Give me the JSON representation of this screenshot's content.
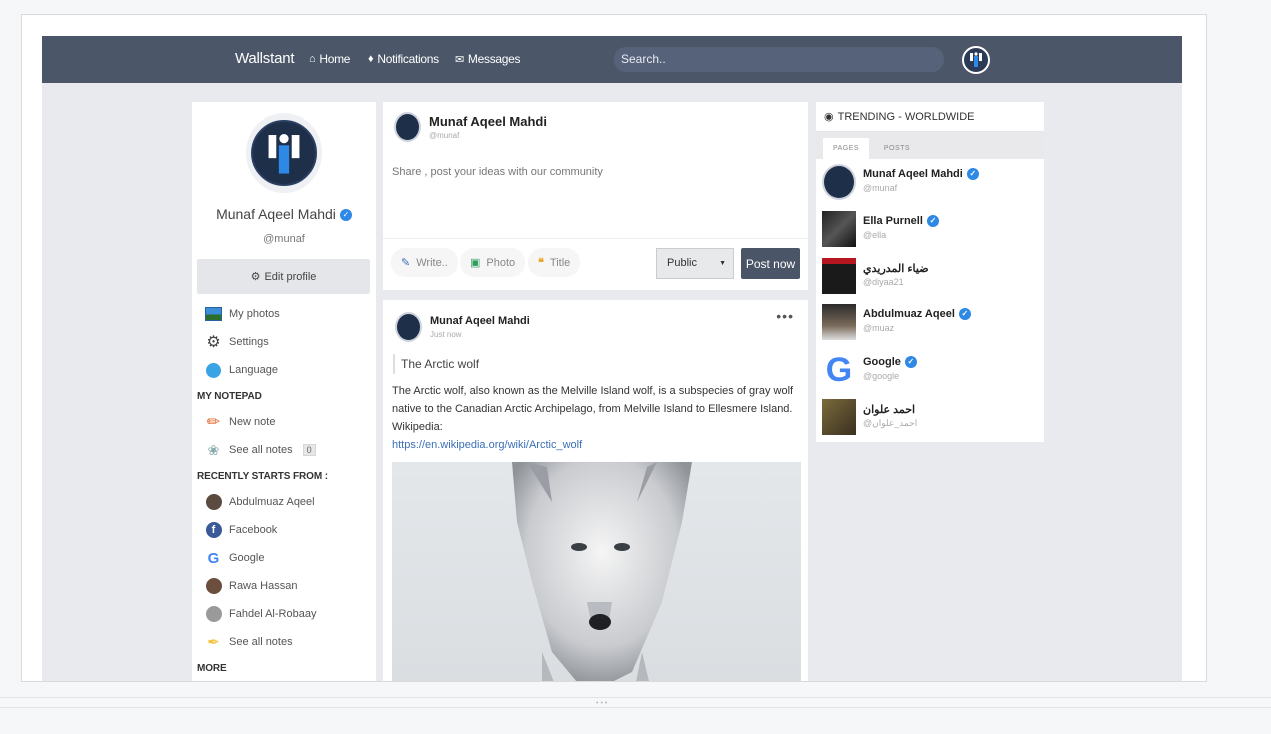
{
  "topbar": {
    "brand": "Wallstant",
    "nav": [
      {
        "label": "Home",
        "icon": "home-icon"
      },
      {
        "label": "Notifications",
        "icon": "bell-icon"
      },
      {
        "label": "Messages",
        "icon": "envelope-icon"
      }
    ],
    "search_placeholder": "Search.."
  },
  "profile": {
    "name": "Munaf Aqeel Mahdi",
    "handle": "@munaf",
    "edit_label": "Edit profile"
  },
  "sidebar": {
    "items": [
      {
        "label": "My photos",
        "icon": "photos-icon"
      },
      {
        "label": "Settings",
        "icon": "gear-icon"
      },
      {
        "label": "Language",
        "icon": "globe-icon"
      }
    ],
    "notepad_heading": "MY NOTEPAD",
    "notepad_items": [
      {
        "label": "New note",
        "icon": "pencil-icon"
      },
      {
        "label": "See all notes",
        "icon": "notes-icon",
        "count": "0"
      }
    ],
    "recent_heading": "RECENTLY STARTS FROM :",
    "recent_items": [
      {
        "label": "Abdulmuaz Aqeel",
        "color": "#5a4a3f"
      },
      {
        "label": "Facebook",
        "color": "#3b5998"
      },
      {
        "label": "Google",
        "color": "#4285f4"
      },
      {
        "label": "Rawa Hassan",
        "color": "#6b4e3d"
      },
      {
        "label": "Fahdel Al-Robaay",
        "color": "#888888"
      },
      {
        "label": "See all notes",
        "color": "#f5c542"
      }
    ],
    "more_heading": "MORE"
  },
  "composer": {
    "name": "Munaf Aqeel Mahdi",
    "handle": "@munaf",
    "placeholder": "Share , post your ideas with our community",
    "tools": [
      {
        "label": "Write..",
        "icon": "pencil-icon",
        "color": "#3b6fb6"
      },
      {
        "label": "Photo",
        "icon": "camera-icon",
        "color": "#2f9e5b"
      },
      {
        "label": "Title",
        "icon": "quote-icon",
        "color": "#f0a020"
      }
    ],
    "privacy": "Public",
    "post_label": "Post now"
  },
  "post": {
    "author": "Munaf Aqeel Mahdi",
    "time": "Just now",
    "more": "•••",
    "title": "The Arctic wolf",
    "body": "The Arctic wolf, also known as the Melville Island wolf, is a subspecies of gray wolf native to the Canadian Arctic Archipelago, from Melville Island to Ellesmere Island. Wikipedia:",
    "link": "https://en.wikipedia.org/wiki/Arctic_wolf"
  },
  "trending": {
    "heading": "TRENDING - WORLDWIDE",
    "tabs": [
      "PAGES",
      "POSTS"
    ],
    "items": [
      {
        "name": "Munaf Aqeel Mahdi",
        "handle": "@munaf",
        "verified": true
      },
      {
        "name": "Ella Purnell",
        "handle": "@ella",
        "verified": true
      },
      {
        "name": "ضياء المدريدي",
        "handle": "@diyaa21",
        "verified": false
      },
      {
        "name": "Abdulmuaz Aqeel",
        "handle": "@muaz",
        "verified": true
      },
      {
        "name": "Google",
        "handle": "@google",
        "verified": true
      },
      {
        "name": "احمد علوان",
        "handle": "@احمد_علوان",
        "verified": false
      }
    ]
  },
  "colors": {
    "topbar": "#4b5668",
    "verified": "#2d88e6",
    "post_button": "#4a5568"
  }
}
